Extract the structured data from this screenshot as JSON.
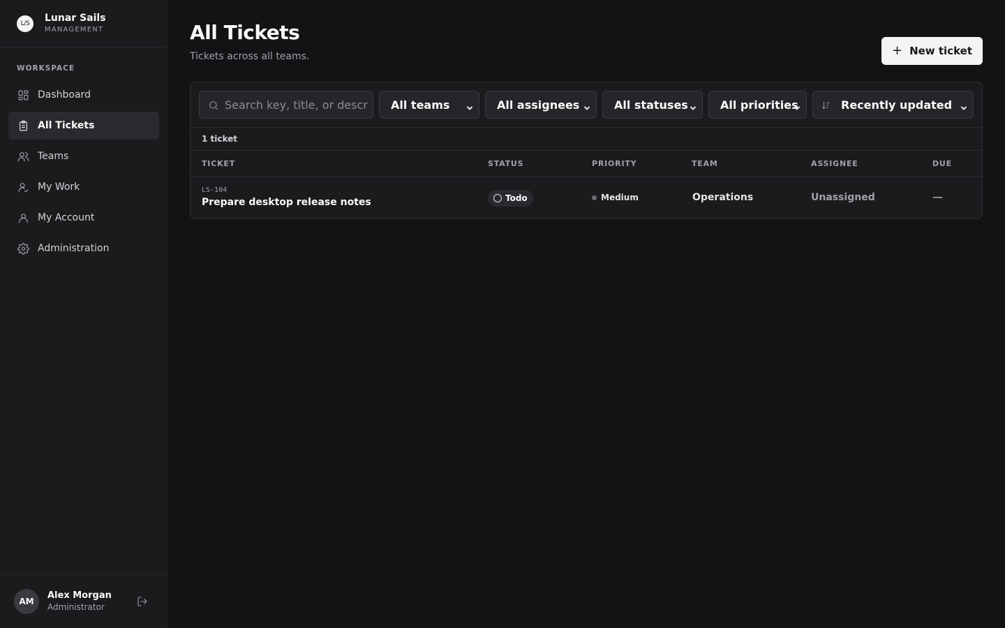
{
  "brand": {
    "logo": "L/S",
    "name": "Lunar Sails",
    "subtitle": "MANAGEMENT"
  },
  "sidebar": {
    "section_label": "WORKSPACE",
    "items": [
      {
        "label": "Dashboard",
        "icon": "dashboard-icon",
        "active": false
      },
      {
        "label": "All Tickets",
        "icon": "clipboard-icon",
        "active": true
      },
      {
        "label": "Teams",
        "icon": "users-icon",
        "active": false
      },
      {
        "label": "My Work",
        "icon": "user-check-icon",
        "active": false
      },
      {
        "label": "My Account",
        "icon": "user-icon",
        "active": false
      },
      {
        "label": "Administration",
        "icon": "gear-icon",
        "active": false
      }
    ]
  },
  "user": {
    "initials": "AM",
    "name": "Alex Morgan",
    "role": "Administrator"
  },
  "header": {
    "title": "All Tickets",
    "subtitle": "Tickets across all teams.",
    "new_ticket_label": "New ticket"
  },
  "filters": {
    "search_placeholder": "Search key, title, or description",
    "team": "All teams",
    "assignee": "All assignees",
    "status": "All statuses",
    "priority": "All priorities",
    "sort": "Recently updated"
  },
  "count_text": "1 ticket",
  "table": {
    "columns": [
      "TICKET",
      "STATUS",
      "PRIORITY",
      "TEAM",
      "ASSIGNEE",
      "DUE"
    ],
    "rows": [
      {
        "key": "LS-104",
        "title": "Prepare desktop release notes",
        "status": "Todo",
        "priority": "Medium",
        "team": "Operations",
        "assignee": "Unassigned",
        "due": "—"
      }
    ]
  },
  "colors": {
    "background": "#131315",
    "sidebar": "#1b1b1e",
    "panel": "#1b1b1e",
    "accent": "#f4f4f5"
  }
}
